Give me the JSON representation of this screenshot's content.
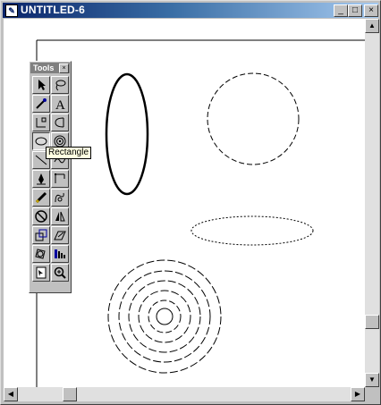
{
  "window": {
    "title": "UNTITLED-6",
    "controls": {
      "minimize": "_",
      "maximize": "□",
      "close": "×"
    }
  },
  "tools_palette": {
    "title": "Tools",
    "close_glyph": "×",
    "tooltip": "Rectangle",
    "tools": [
      {
        "name": "pointer-tool",
        "icon": "arrow-icon"
      },
      {
        "name": "lasso-tool",
        "icon": "lasso-icon"
      },
      {
        "name": "eyedropper-tool",
        "icon": "eyedropper-icon"
      },
      {
        "name": "text-tool",
        "icon": "text-icon",
        "glyph": "A"
      },
      {
        "name": "line-corner-tool",
        "icon": "corner-icon"
      },
      {
        "name": "arc-tool",
        "icon": "arc-icon"
      },
      {
        "name": "ellipse-tool",
        "icon": "ellipse-icon",
        "active": true
      },
      {
        "name": "spiral-tool",
        "icon": "spiral-icon"
      },
      {
        "name": "line-tool",
        "icon": "line-icon"
      },
      {
        "name": "freehand-tool",
        "icon": "freehand-icon"
      },
      {
        "name": "pen-tool",
        "icon": "pen-icon"
      },
      {
        "name": "knife-tool",
        "icon": "knife-icon"
      },
      {
        "name": "pencil-tool",
        "icon": "pencil-icon"
      },
      {
        "name": "bezigon-tool",
        "icon": "bezigon-icon"
      },
      {
        "name": "no-stroke-tool",
        "icon": "no-icon"
      },
      {
        "name": "reflect-tool",
        "icon": "reflect-icon"
      },
      {
        "name": "scale-tool",
        "icon": "scale-icon"
      },
      {
        "name": "skew-tool",
        "icon": "skew-icon"
      },
      {
        "name": "rotate-tool",
        "icon": "rotate-icon"
      },
      {
        "name": "blend-tool",
        "icon": "blend-icon"
      },
      {
        "name": "page-tool",
        "icon": "page-icon"
      },
      {
        "name": "zoom-tool",
        "icon": "zoom-icon"
      }
    ]
  },
  "colors": {
    "title_start": "#0a246a",
    "title_end": "#a6caf0",
    "tooltip_bg": "#ffffe1"
  }
}
